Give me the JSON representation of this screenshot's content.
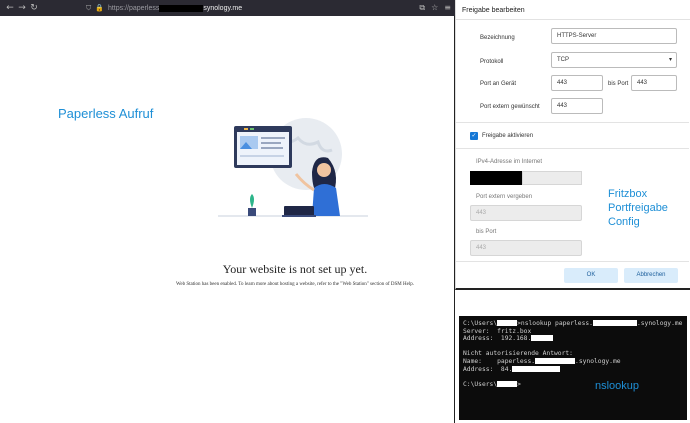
{
  "browser": {
    "url_prefix": "https://paperless",
    "url_suffix": "synology.me",
    "nav_back": "←",
    "nav_forward": "→",
    "nav_reload": "↻",
    "icon_shield": "⛉",
    "icon_lock": "🔒",
    "icon_translate": "⧉",
    "icon_star": "☆",
    "icon_menu": "≡"
  },
  "annotations": {
    "paperless": "Paperless Aufruf",
    "fritzbox_line1": "Fritzbox",
    "fritzbox_line2": "Portfreigabe",
    "fritzbox_line3": "Config",
    "nslookup": "nslookup"
  },
  "website": {
    "title": "Your website is not set up yet.",
    "subtitle": "Web Station has been enabled. To learn more about hosting a website, refer to the \"Web Station\" section of DSM Help."
  },
  "dialog": {
    "title": "Freigabe bearbeiten",
    "label_name": "Bezeichnung",
    "value_name": "HTTPS-Server",
    "label_protocol": "Protokoll",
    "value_protocol": "TCP",
    "label_port_device": "Port an Gerät",
    "value_port_device": "443",
    "label_bis_port": "bis Port",
    "value_bis_port": "443",
    "label_port_external": "Port extern gewünscht",
    "value_port_external": "443",
    "checkbox_label": "Freigabe aktivieren",
    "checkbox_checked": true,
    "label_ipv4": "IPv4-Adresse im Internet",
    "label_port_assigned": "Port extern vergeben",
    "value_port_assigned": "443",
    "label_bis_port2": "bis Port",
    "value_bis_port2": "443",
    "ok_label": "OK",
    "cancel_label": "Abbrechen",
    "accent_color": "#1678d6"
  },
  "terminal": {
    "line1_a": "C:\\Users\\",
    "line1_b": ">nslookup paperless.",
    "line1_c": ".synology.me",
    "line2": "Server:  fritz.box",
    "line3_a": "Address:  192.168.",
    "line4": "Nicht autorisierende Antwort:",
    "line5_a": "Name:    paperless.",
    "line5_b": ".synology.me",
    "line6_a": "Address:  84.",
    "line7_a": "C:\\Users\\",
    "line7_b": ">"
  }
}
